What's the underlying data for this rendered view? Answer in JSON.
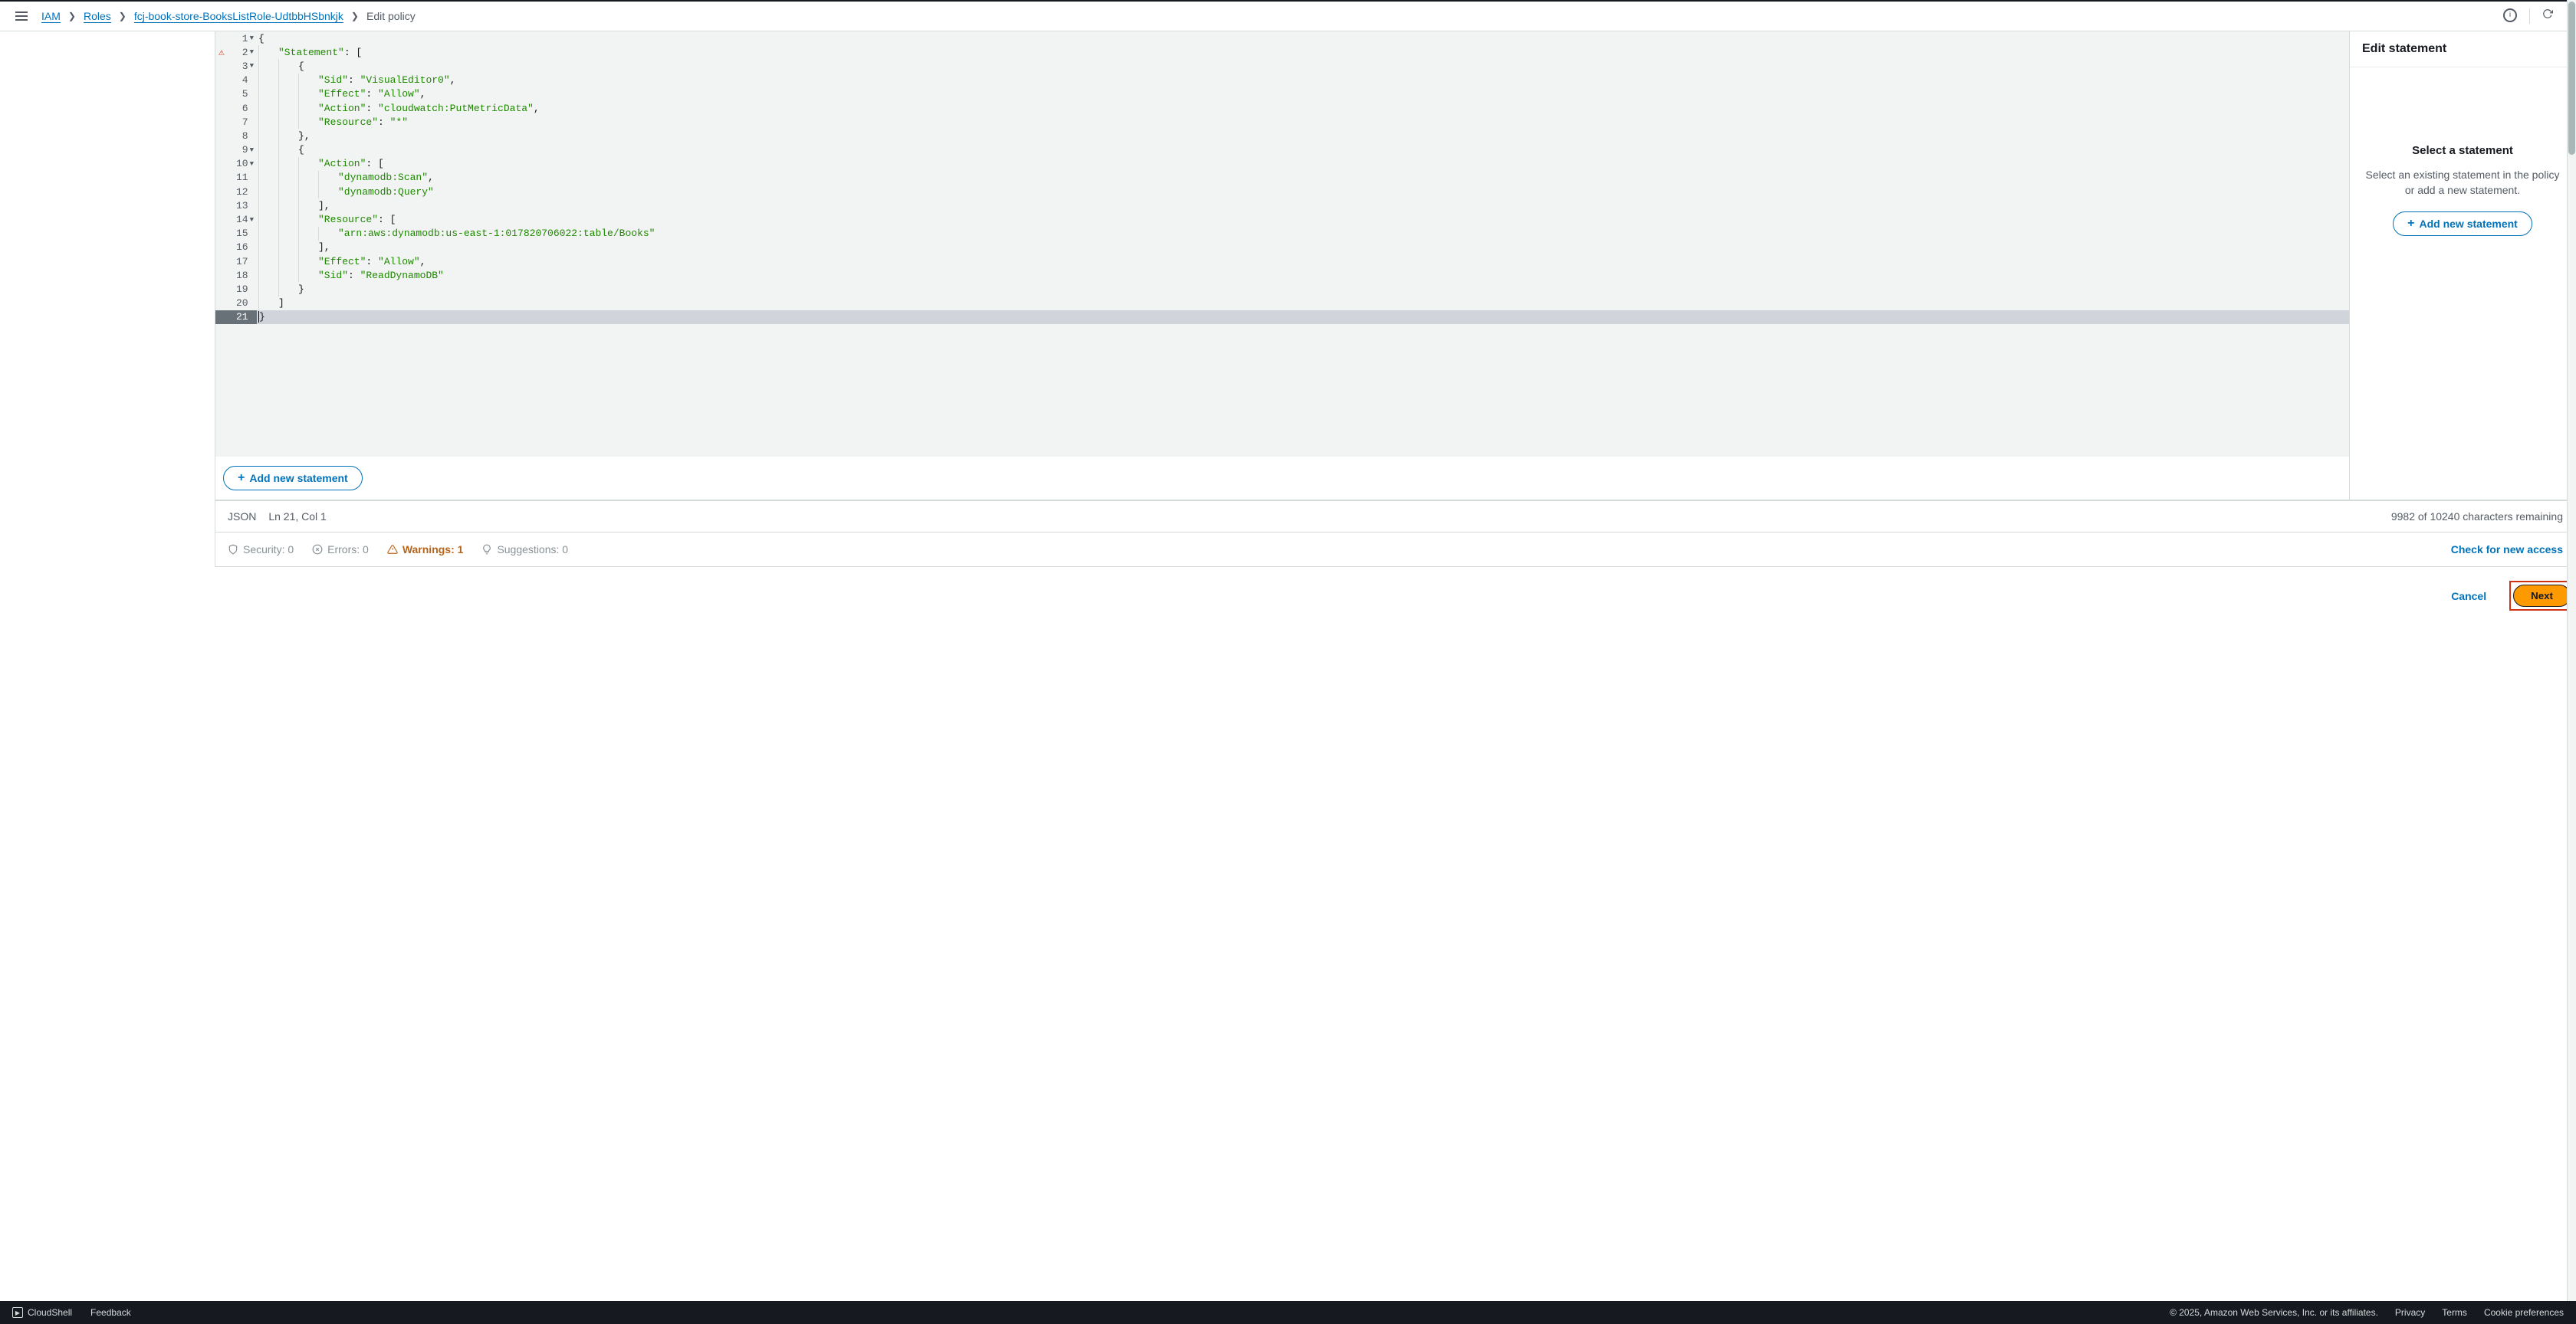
{
  "breadcrumbs": {
    "iam": "IAM",
    "roles": "Roles",
    "role": "fcj-book-store-BooksListRole-UdtbbHSbnkjk",
    "current": "Edit policy"
  },
  "editor": {
    "lines": [
      {
        "n": 1,
        "fold": true,
        "tokens": [
          [
            "{",
            "p"
          ]
        ]
      },
      {
        "n": 2,
        "fold": true,
        "warn": true,
        "tokens": [
          [
            "    ",
            "w"
          ],
          [
            "\"Statement\"",
            "k"
          ],
          [
            ": [",
            "p"
          ]
        ]
      },
      {
        "n": 3,
        "fold": true,
        "tokens": [
          [
            "        ",
            "w"
          ],
          [
            "{",
            "p"
          ]
        ]
      },
      {
        "n": 4,
        "tokens": [
          [
            "            ",
            "w"
          ],
          [
            "\"Sid\"",
            "k"
          ],
          [
            ": ",
            "p"
          ],
          [
            "\"VisualEditor0\"",
            "s"
          ],
          [
            ",",
            "p"
          ]
        ]
      },
      {
        "n": 5,
        "tokens": [
          [
            "            ",
            "w"
          ],
          [
            "\"Effect\"",
            "k"
          ],
          [
            ": ",
            "p"
          ],
          [
            "\"Allow\"",
            "s"
          ],
          [
            ",",
            "p"
          ]
        ]
      },
      {
        "n": 6,
        "tokens": [
          [
            "            ",
            "w"
          ],
          [
            "\"Action\"",
            "k"
          ],
          [
            ": ",
            "p"
          ],
          [
            "\"cloudwatch:PutMetricData\"",
            "s"
          ],
          [
            ",",
            "p"
          ]
        ]
      },
      {
        "n": 7,
        "tokens": [
          [
            "            ",
            "w"
          ],
          [
            "\"Resource\"",
            "k"
          ],
          [
            ": ",
            "p"
          ],
          [
            "\"*\"",
            "s"
          ]
        ]
      },
      {
        "n": 8,
        "tokens": [
          [
            "        ",
            "w"
          ],
          [
            "},",
            "p"
          ]
        ]
      },
      {
        "n": 9,
        "fold": true,
        "tokens": [
          [
            "        ",
            "w"
          ],
          [
            "{",
            "p"
          ]
        ]
      },
      {
        "n": 10,
        "fold": true,
        "tokens": [
          [
            "            ",
            "w"
          ],
          [
            "\"Action\"",
            "k"
          ],
          [
            ": [",
            "p"
          ]
        ]
      },
      {
        "n": 11,
        "tokens": [
          [
            "                ",
            "w"
          ],
          [
            "\"dynamodb:Scan\"",
            "s"
          ],
          [
            ",",
            "p"
          ]
        ]
      },
      {
        "n": 12,
        "tokens": [
          [
            "                ",
            "w"
          ],
          [
            "\"dynamodb:Query\"",
            "s"
          ]
        ]
      },
      {
        "n": 13,
        "tokens": [
          [
            "            ",
            "w"
          ],
          [
            "],",
            "p"
          ]
        ]
      },
      {
        "n": 14,
        "fold": true,
        "tokens": [
          [
            "            ",
            "w"
          ],
          [
            "\"Resource\"",
            "k"
          ],
          [
            ": [",
            "p"
          ]
        ]
      },
      {
        "n": 15,
        "tokens": [
          [
            "                ",
            "w"
          ],
          [
            "\"arn:aws:dynamodb:us-east-1:017820706022:table/Books\"",
            "s"
          ]
        ]
      },
      {
        "n": 16,
        "tokens": [
          [
            "            ",
            "w"
          ],
          [
            "],",
            "p"
          ]
        ]
      },
      {
        "n": 17,
        "tokens": [
          [
            "            ",
            "w"
          ],
          [
            "\"Effect\"",
            "k"
          ],
          [
            ": ",
            "p"
          ],
          [
            "\"Allow\"",
            "s"
          ],
          [
            ",",
            "p"
          ]
        ]
      },
      {
        "n": 18,
        "tokens": [
          [
            "            ",
            "w"
          ],
          [
            "\"Sid\"",
            "k"
          ],
          [
            ": ",
            "p"
          ],
          [
            "\"ReadDynamoDB\"",
            "s"
          ]
        ]
      },
      {
        "n": 19,
        "tokens": [
          [
            "        ",
            "w"
          ],
          [
            "}",
            "p"
          ]
        ]
      },
      {
        "n": 20,
        "tokens": [
          [
            "    ",
            "w"
          ],
          [
            "]",
            "p"
          ]
        ]
      },
      {
        "n": 21,
        "active": true,
        "tokens": [
          [
            "}",
            "p"
          ]
        ]
      }
    ],
    "add_button": "Add new statement",
    "status_lang": "JSON",
    "status_pos": "Ln 21, Col 1",
    "status_chars": "9982 of 10240 characters remaining"
  },
  "side": {
    "title": "Edit statement",
    "heading": "Select a statement",
    "body": "Select an existing statement in the policy or add a new statement.",
    "add": "Add new statement"
  },
  "issues": {
    "security": "Security: 0",
    "errors": "Errors: 0",
    "warnings": "Warnings: 1",
    "suggestions": "Suggestions: 0",
    "check": "Check for new access"
  },
  "actions": {
    "cancel": "Cancel",
    "next": "Next"
  },
  "footer": {
    "cloudshell": "CloudShell",
    "feedback": "Feedback",
    "copyright": "© 2025, Amazon Web Services, Inc. or its affiliates.",
    "privacy": "Privacy",
    "terms": "Terms",
    "cookies": "Cookie preferences"
  }
}
